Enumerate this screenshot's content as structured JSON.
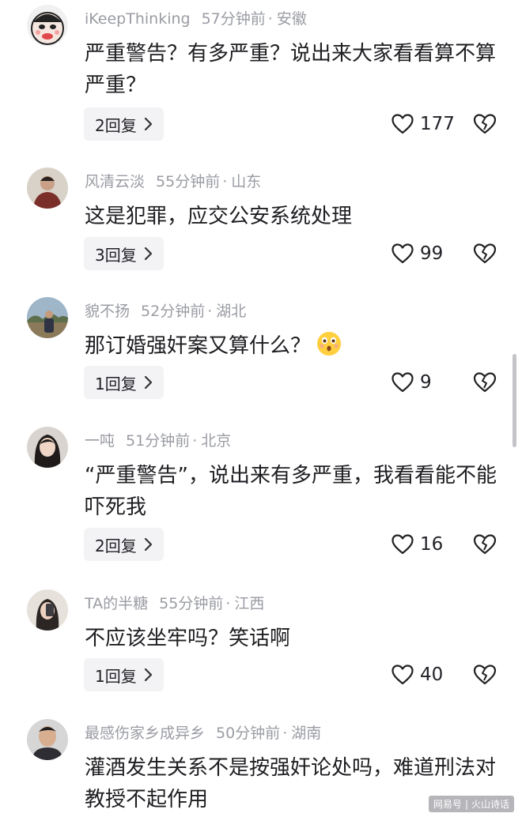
{
  "comments": [
    {
      "username": "iKeepThinking",
      "time": "57分钟前",
      "location": "安徽",
      "text": "严重警告？有多严重？说出来大家看看算不算严重？",
      "replies": "2回复",
      "likes": "177",
      "avatar_icon": "cartoon-face-avatar"
    },
    {
      "username": "风清云淡",
      "time": "55分钟前",
      "location": "山东",
      "text": "这是犯罪，应交公安系统处理",
      "replies": "3回复",
      "likes": "99",
      "avatar_icon": "person-photo-avatar"
    },
    {
      "username": "貌不扬",
      "time": "52分钟前",
      "location": "湖北",
      "text": "那订婚强奸案又算什么？",
      "emoji": "shocked-face-emoji",
      "replies": "1回复",
      "likes": "9",
      "avatar_icon": "outdoor-photo-avatar"
    },
    {
      "username": "一吨",
      "time": "51分钟前",
      "location": "北京",
      "text": "“严重警告”，说出来有多严重，我看看能不能吓死我",
      "replies": "2回复",
      "likes": "16",
      "avatar_icon": "woman-photo-avatar"
    },
    {
      "username": "TA的半糖",
      "time": "55分钟前",
      "location": "江西",
      "text": "不应该坐牢吗？笑话啊",
      "replies": "1回复",
      "likes": "40",
      "avatar_icon": "selfie-photo-avatar"
    },
    {
      "username": "最感伤家乡成异乡",
      "time": "50分钟前",
      "location": "湖南",
      "text": "灌酒发生关系不是按强奸论处吗，难道刑法对教授不起作用",
      "avatar_icon": "man-photo-avatar"
    }
  ],
  "separator": "·",
  "watermark": {
    "left": "网易号",
    "right": "火山诗话"
  },
  "icons": {
    "like": "heart-outline-icon",
    "dislike": "broken-heart-icon",
    "chevron": "chevron-right-icon"
  },
  "colors": {
    "meta_text": "#9a9ca3",
    "body_text": "#1e1e22",
    "reply_bg": "#f3f3f5"
  }
}
